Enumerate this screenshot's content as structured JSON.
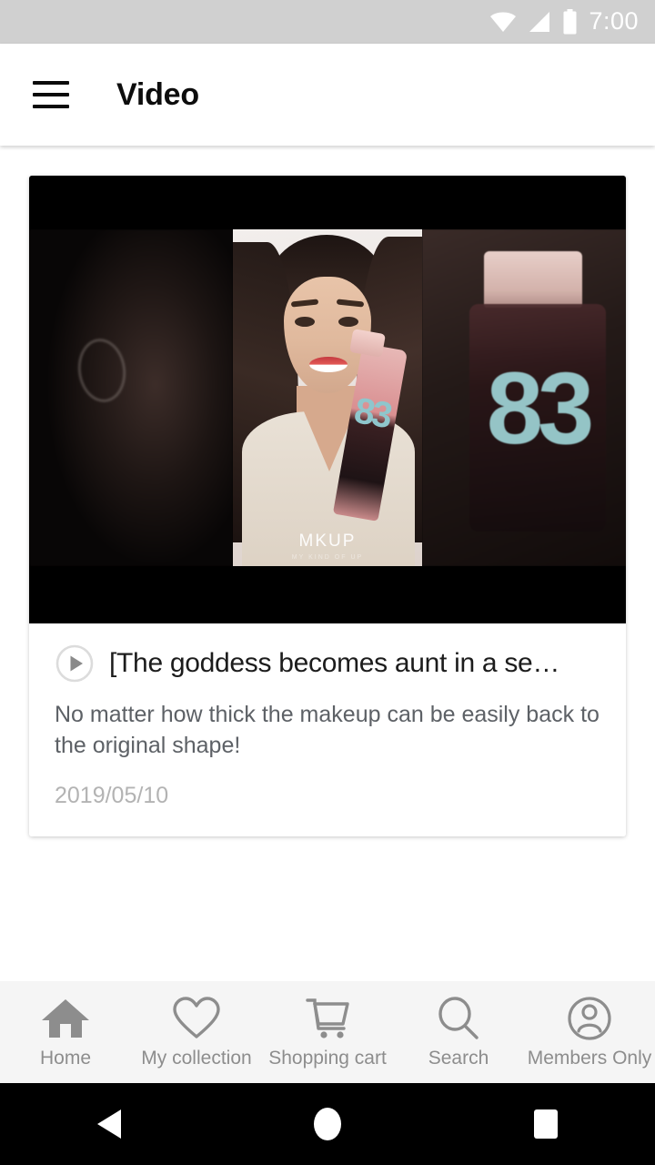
{
  "status_bar": {
    "time": "7:00",
    "icons": [
      "wifi-icon",
      "cellular-signal-icon",
      "battery-icon"
    ],
    "background_color": "#d0d0d0",
    "icon_color": "#ffffff"
  },
  "app_bar": {
    "menu_icon": "hamburger-menu-icon",
    "title": "Video",
    "background_color": "#ffffff"
  },
  "video_card": {
    "thumbnail": {
      "alt": "Woman holding pink MKUP cleansing water bottle",
      "watermark": "MKUP",
      "watermark_sub": "MY KIND OF UP",
      "bottle_number": "83",
      "letterbox_color": "#000000"
    },
    "play_icon": "play-circle-icon",
    "title": "[The goddess becomes aunt in a se…",
    "subtitle": "No matter how thick the makeup can be easily back to the original shape!",
    "date": "2019/05/10"
  },
  "bottom_nav": {
    "background_color": "#f5f5f5",
    "item_color": "#8d8d8d",
    "items": [
      {
        "label": "Home",
        "icon": "home-icon"
      },
      {
        "label": "My collection",
        "icon": "heart-icon"
      },
      {
        "label": "Shopping cart",
        "icon": "shopping-cart-icon"
      },
      {
        "label": "Search",
        "icon": "search-icon"
      },
      {
        "label": "Members Only",
        "icon": "account-circle-icon"
      }
    ]
  },
  "android_nav": {
    "background_color": "#000000",
    "buttons": [
      {
        "name": "back-button",
        "icon": "triangle-left-icon"
      },
      {
        "name": "home-button",
        "icon": "circle-icon"
      },
      {
        "name": "recents-button",
        "icon": "square-icon"
      }
    ]
  }
}
